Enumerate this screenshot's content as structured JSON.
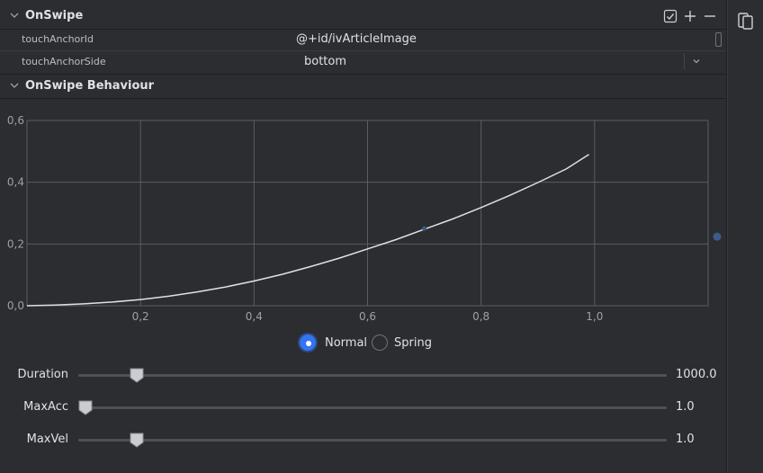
{
  "onswipe": {
    "title": "OnSwipe",
    "tools": [
      "checkbox-icon",
      "add-icon",
      "remove-icon"
    ],
    "attributes": [
      {
        "key": "touchAnchorId",
        "value": "@+id/ivArticleImage"
      },
      {
        "key": "touchAnchorSide",
        "value": "bottom"
      }
    ]
  },
  "behaviour": {
    "title": "OnSwipe Behaviour"
  },
  "chart_data": {
    "type": "line",
    "title": "",
    "xlabel": "",
    "ylabel": "",
    "xlim": [
      0.0,
      1.2
    ],
    "ylim": [
      0.0,
      0.6
    ],
    "x_ticks": [
      "0,2",
      "0,4",
      "0,6",
      "0,8",
      "1,0"
    ],
    "y_ticks": [
      "0,0",
      "0,2",
      "0,4",
      "0,6"
    ],
    "grid": true,
    "series": [
      {
        "x": [
          0.0,
          0.05,
          0.1,
          0.15,
          0.2,
          0.25,
          0.3,
          0.35,
          0.4,
          0.45,
          0.5,
          0.55,
          0.6,
          0.65,
          0.7,
          0.75,
          0.8,
          0.85,
          0.9,
          0.95,
          0.99
        ],
        "y": [
          0.0,
          0.002,
          0.006,
          0.012,
          0.02,
          0.031,
          0.045,
          0.061,
          0.08,
          0.102,
          0.127,
          0.154,
          0.184,
          0.214,
          0.248,
          0.281,
          0.318,
          0.357,
          0.399,
          0.443,
          0.49
        ]
      }
    ],
    "marker_point": {
      "x": 0.7,
      "y": 0.25
    },
    "side_point_level": 0.25,
    "colors": {
      "line": "#dfe1e5",
      "grid": "#5a5d63",
      "marker": "#3d5a8a",
      "tick_label": "#9da0a6"
    }
  },
  "mode": {
    "options": [
      "Normal",
      "Spring"
    ],
    "selected": "Normal",
    "accent": "#3574f0"
  },
  "sliders": [
    {
      "label": "Duration",
      "value": "1000.0",
      "level": 0.09
    },
    {
      "label": "MaxAcc",
      "value": "1.0",
      "level": 0.0
    },
    {
      "label": "MaxVel",
      "value": "1.0",
      "level": 0.09
    }
  ]
}
